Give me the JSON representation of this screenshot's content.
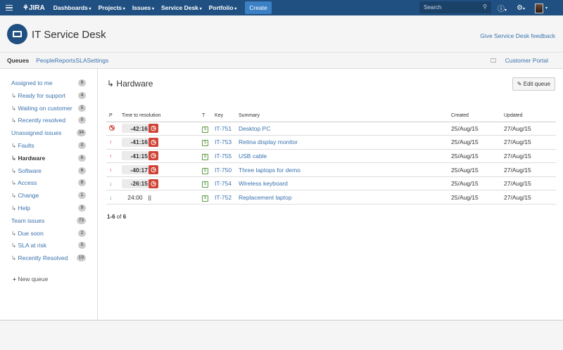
{
  "topbar": {
    "logo": "JIRA",
    "menus": [
      "Dashboards",
      "Projects",
      "Issues",
      "Service Desk",
      "Portfolio"
    ],
    "create": "Create",
    "search_placeholder": "Search"
  },
  "project": {
    "title": "IT Service Desk",
    "feedback": "Give Service Desk feedback"
  },
  "tabs": [
    "Queues",
    "People",
    "Reports",
    "SLA",
    "Settings"
  ],
  "customer_portal": "Customer Portal",
  "queues": [
    {
      "label": "Assigned to me",
      "count": "9",
      "sub": false
    },
    {
      "label": "Ready for support",
      "count": "4",
      "sub": true
    },
    {
      "label": "Waiting on customer",
      "count": "5",
      "sub": true
    },
    {
      "label": "Recently resolved",
      "count": "0",
      "sub": true
    },
    {
      "label": "Unassigned issues",
      "count": "34",
      "sub": false
    },
    {
      "label": "Faults",
      "count": "0",
      "sub": true
    },
    {
      "label": "Hardware",
      "count": "6",
      "sub": true,
      "selected": true
    },
    {
      "label": "Software",
      "count": "6",
      "sub": true
    },
    {
      "label": "Access",
      "count": "8",
      "sub": true
    },
    {
      "label": "Change",
      "count": "1",
      "sub": true
    },
    {
      "label": "Help",
      "count": "9",
      "sub": true
    },
    {
      "label": "Team issues",
      "count": "73",
      "sub": false
    },
    {
      "label": "Due soon",
      "count": "2",
      "sub": true
    },
    {
      "label": "SLA at risk",
      "count": "0",
      "sub": true
    },
    {
      "label": "Recently Resolved",
      "count": "19",
      "sub": true
    }
  ],
  "new_queue": "New queue",
  "main": {
    "title": "Hardware",
    "edit": "Edit queue",
    "columns": [
      "P",
      "Time to resolution",
      "T",
      "Key",
      "Summary",
      "Created",
      "Updated"
    ],
    "rows": [
      {
        "priority": "blocker",
        "sla": "-42:16",
        "breached": true,
        "key": "IT-751",
        "summary": "Desktop PC",
        "created": "25/Aug/15",
        "updated": "27/Aug/15"
      },
      {
        "priority": "high",
        "sla": "-41:16",
        "breached": true,
        "key": "IT-753",
        "summary": "Retina display monitor",
        "created": "25/Aug/15",
        "updated": "27/Aug/15"
      },
      {
        "priority": "high",
        "sla": "-41:15",
        "breached": true,
        "key": "IT-755",
        "summary": "USB cable",
        "created": "25/Aug/15",
        "updated": "27/Aug/15"
      },
      {
        "priority": "high",
        "sla": "-40:17",
        "breached": true,
        "key": "IT-750",
        "summary": "Three laptops for demo",
        "created": "25/Aug/15",
        "updated": "27/Aug/15"
      },
      {
        "priority": "low",
        "sla": "-26:15",
        "breached": true,
        "key": "IT-754",
        "summary": "Wireless keyboard",
        "created": "25/Aug/15",
        "updated": "27/Aug/15"
      },
      {
        "priority": "low",
        "sla": "24:00",
        "breached": false,
        "key": "IT-752",
        "summary": "Replacement laptop",
        "created": "25/Aug/15",
        "updated": "27/Aug/15"
      }
    ],
    "count_range": "1-6",
    "count_of": "of",
    "count_total": "6"
  },
  "colors": {
    "topbar": "#205081",
    "link": "#3b73af",
    "breach": "#d04437"
  }
}
